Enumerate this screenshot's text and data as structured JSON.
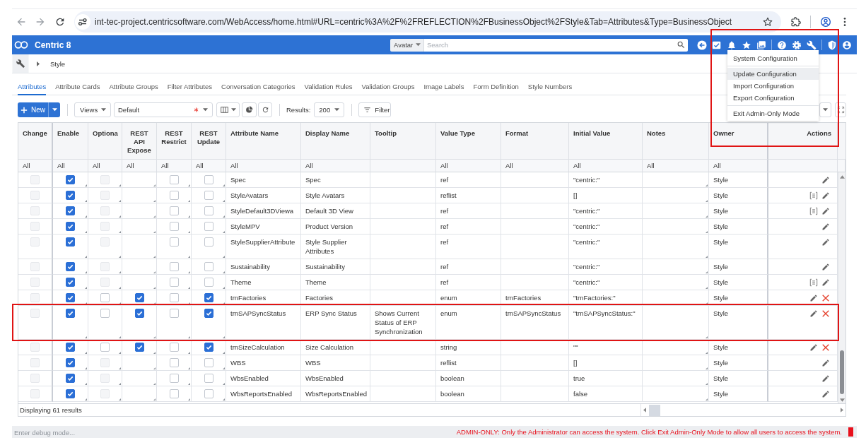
{
  "browser": {
    "url": "int-tec-project.centricsoftware.com/WebAccess/home.html#URL=centric%3A%2F%2FREFLECTION%2FBusinessObject%2FStyle&Tab=Attributes&Type=BusinessObject"
  },
  "app_header": {
    "title": "Centric 8",
    "search_scope": "Avatar",
    "search_placeholder": "Search"
  },
  "admin_menu": {
    "annotated": true,
    "groups": [
      {
        "items": [
          {
            "label": "System Configuration",
            "highlighted": false
          }
        ]
      },
      {
        "items": [
          {
            "label": "Update Configuration",
            "highlighted": true
          },
          {
            "label": "Import Configuration",
            "highlighted": false
          },
          {
            "label": "Export Configuration",
            "highlighted": false
          }
        ]
      },
      {
        "items": [
          {
            "label": "Exit Admin-Only Mode",
            "highlighted": false
          }
        ]
      }
    ]
  },
  "breadcrumb": [
    "Style"
  ],
  "tabs": [
    {
      "label": "Attributes",
      "selected": true
    },
    {
      "label": "Attribute Cards",
      "selected": false
    },
    {
      "label": "Attribute Groups",
      "selected": false
    },
    {
      "label": "Filter Attributes",
      "selected": false
    },
    {
      "label": "Conversation Categories",
      "selected": false
    },
    {
      "label": "Validation Rules",
      "selected": false
    },
    {
      "label": "Validation Groups",
      "selected": false
    },
    {
      "label": "Image Labels",
      "selected": false
    },
    {
      "label": "Form Definition",
      "selected": false
    },
    {
      "label": "Style Numbers",
      "selected": false
    }
  ],
  "toolbar": {
    "new_label": "New",
    "views_label": "Views",
    "view": {
      "value": "Default",
      "required": true
    },
    "results_label": "Results:",
    "results_value": "200",
    "filter_label": "Filter"
  },
  "table": {
    "columns": [
      {
        "label": "Change",
        "filter": "All",
        "editable": false
      },
      {
        "label": "Enable",
        "filter": "All",
        "editable": true
      },
      {
        "label": "Optiona",
        "filter": "All",
        "editable": true
      },
      {
        "label": "REST API Expose",
        "filter": "All",
        "editable": true
      },
      {
        "label": "REST Restrict",
        "filter": "All",
        "editable": true
      },
      {
        "label": "REST Update",
        "filter": "All",
        "editable": true
      },
      {
        "label": "Attribute Name",
        "filter": "All",
        "editable": false
      },
      {
        "label": "Display Name",
        "filter": "All",
        "editable": false
      },
      {
        "label": "Tooltip",
        "editable": false
      },
      {
        "label": "Value Type",
        "filter": "All",
        "editable": false
      },
      {
        "label": "Format",
        "filter": "All",
        "editable": false
      },
      {
        "label": "Initial Value",
        "filter": "All",
        "editable": false
      },
      {
        "label": "Notes",
        "filter": "All",
        "editable": true
      },
      {
        "label": "Owner",
        "filter": "All",
        "editable": false
      },
      {
        "label": "Actions",
        "editable": false
      }
    ],
    "rows": [
      {
        "change": {
          "checked": false,
          "disabled": true
        },
        "enabled": {
          "checked": true,
          "disabled": false
        },
        "optional": {
          "checked": false,
          "disabled": true
        },
        "rest_restrict": {
          "checked": false,
          "disabled": false
        },
        "rest_update": {
          "checked": false,
          "disabled": false
        },
        "attribute_name": "Spec",
        "display_name": "Spec",
        "value_type": "ref",
        "initial_value": "\"centric:\"",
        "owner": "Style",
        "details": false,
        "deletable": false,
        "annotated": false
      },
      {
        "change": {
          "checked": false,
          "disabled": true
        },
        "enabled": {
          "checked": true,
          "disabled": false
        },
        "optional": {
          "checked": false,
          "disabled": true
        },
        "rest_restrict": {
          "checked": false,
          "disabled": false
        },
        "rest_update": {
          "checked": false,
          "disabled": false
        },
        "attribute_name": "StyleAvatars",
        "display_name": "Style Avatars",
        "value_type": "reflist",
        "initial_value": "[]",
        "owner": "Style",
        "details": true,
        "deletable": false,
        "annotated": false
      },
      {
        "change": {
          "checked": false,
          "disabled": true
        },
        "enabled": {
          "checked": true,
          "disabled": false
        },
        "optional": {
          "checked": false,
          "disabled": true
        },
        "rest_restrict": {
          "checked": false,
          "disabled": false
        },
        "rest_update": {
          "checked": false,
          "disabled": false
        },
        "attribute_name": "StyleDefault3DViewa",
        "display_name": "Default 3D View",
        "value_type": "ref",
        "initial_value": "\"centric:\"",
        "owner": "Style",
        "details": true,
        "deletable": false,
        "annotated": false
      },
      {
        "change": {
          "checked": false,
          "disabled": true
        },
        "enabled": {
          "checked": true,
          "disabled": false
        },
        "optional": {
          "checked": false,
          "disabled": true
        },
        "rest_restrict": {
          "checked": false,
          "disabled": false
        },
        "rest_update": {
          "checked": false,
          "disabled": false
        },
        "attribute_name": "StyleMPV",
        "display_name": "Product Version",
        "value_type": "ref",
        "initial_value": "\"centric:\"",
        "owner": "Style",
        "details": false,
        "deletable": false,
        "annotated": false
      },
      {
        "change": {
          "checked": false,
          "disabled": true
        },
        "enabled": {
          "checked": true,
          "disabled": false
        },
        "optional": {
          "checked": false,
          "disabled": true
        },
        "rest_restrict": {
          "checked": false,
          "disabled": false
        },
        "rest_update": {
          "checked": false,
          "disabled": false
        },
        "attribute_name": "StyleSupplierAttribute",
        "display_name": "Style Supplier Attributes",
        "value_type": "ref",
        "initial_value": "\"centric:\"",
        "owner": "Style",
        "details": false,
        "deletable": false,
        "annotated": false
      },
      {
        "change": {
          "checked": false,
          "disabled": true
        },
        "enabled": {
          "checked": true,
          "disabled": false
        },
        "optional": {
          "checked": false,
          "disabled": true
        },
        "rest_restrict": {
          "checked": false,
          "disabled": false
        },
        "rest_update": {
          "checked": false,
          "disabled": false
        },
        "attribute_name": "Sustainability",
        "display_name": "Sustainability",
        "value_type": "ref",
        "initial_value": "\"centric:\"",
        "owner": "Style",
        "details": false,
        "deletable": false,
        "annotated": false
      },
      {
        "change": {
          "checked": false,
          "disabled": true
        },
        "enabled": {
          "checked": true,
          "disabled": false
        },
        "optional": {
          "checked": false,
          "disabled": true
        },
        "rest_restrict": {
          "checked": false,
          "disabled": false
        },
        "rest_update": {
          "checked": false,
          "disabled": false
        },
        "attribute_name": "Theme",
        "display_name": "Theme",
        "value_type": "ref",
        "initial_value": "\"centric:\"",
        "owner": "Style",
        "details": true,
        "deletable": false,
        "annotated": false
      },
      {
        "change": {
          "checked": false,
          "disabled": true
        },
        "enabled": {
          "checked": true,
          "disabled": false
        },
        "optional": {
          "checked": false,
          "disabled": false
        },
        "rest_api_exposed": {
          "checked": true,
          "disabled": false
        },
        "rest_restrict": {
          "checked": false,
          "disabled": false
        },
        "rest_update": {
          "checked": true,
          "disabled": false
        },
        "attribute_name": "trnFactories",
        "display_name": "Factories",
        "value_type": "enum",
        "format": "trnFactories",
        "initial_value": "\"trnFactories:\"",
        "owner": "Style",
        "details": false,
        "deletable": true,
        "annotated": false
      },
      {
        "change": {
          "checked": false,
          "disabled": true
        },
        "enabled": {
          "checked": true,
          "disabled": false
        },
        "optional": {
          "checked": false,
          "disabled": false
        },
        "rest_api_exposed": {
          "checked": true,
          "disabled": false
        },
        "rest_restrict": {
          "checked": false,
          "disabled": false
        },
        "rest_update": {
          "checked": true,
          "disabled": false
        },
        "attribute_name": "trnSAPSyncStatus",
        "display_name": "ERP Sync Status",
        "tooltip": "Shows Current Status of ERP Synchronization",
        "value_type": "enum",
        "format": "trnSAPSyncStatus",
        "initial_value": "\"trnSAPSyncStatus:\"",
        "owner": "Style",
        "details": false,
        "deletable": true,
        "annotated": true
      },
      {
        "change": {
          "checked": false,
          "disabled": true
        },
        "enabled": {
          "checked": true,
          "disabled": false
        },
        "optional": {
          "checked": false,
          "disabled": false
        },
        "rest_api_exposed": {
          "checked": true,
          "disabled": false
        },
        "rest_restrict": {
          "checked": false,
          "disabled": false
        },
        "rest_update": {
          "checked": true,
          "disabled": false
        },
        "attribute_name": "trnSizeCalculation",
        "display_name": "Size Calculation",
        "value_type": "string",
        "initial_value": "\"\"",
        "owner": "Style",
        "details": false,
        "deletable": true,
        "annotated": false
      },
      {
        "change": {
          "checked": false,
          "disabled": true
        },
        "enabled": {
          "checked": true,
          "disabled": false
        },
        "optional": {
          "checked": false,
          "disabled": true
        },
        "rest_restrict": {
          "checked": false,
          "disabled": false
        },
        "rest_update": {
          "checked": false,
          "disabled": false
        },
        "attribute_name": "WBS",
        "display_name": "WBS",
        "value_type": "reflist",
        "initial_value": "[]",
        "owner": "Style",
        "details": false,
        "deletable": false,
        "annotated": false
      },
      {
        "change": {
          "checked": false,
          "disabled": true
        },
        "enabled": {
          "checked": true,
          "disabled": false
        },
        "optional": {
          "checked": false,
          "disabled": true
        },
        "rest_restrict": {
          "checked": false,
          "disabled": false
        },
        "rest_update": {
          "checked": false,
          "disabled": false
        },
        "attribute_name": "WbsEnabled",
        "display_name": "WbsEnabled",
        "value_type": "boolean",
        "initial_value": "true",
        "owner": "Style",
        "details": false,
        "deletable": false,
        "annotated": false
      },
      {
        "change": {
          "checked": false,
          "disabled": true
        },
        "enabled": {
          "checked": true,
          "disabled": false
        },
        "optional": {
          "checked": false,
          "disabled": true
        },
        "rest_restrict": {
          "checked": false,
          "disabled": false
        },
        "rest_update": {
          "checked": false,
          "disabled": false
        },
        "attribute_name": "WbsReportsEnabled",
        "display_name": "WbsReportsEnabled",
        "value_type": "boolean",
        "initial_value": "false",
        "owner": "Style",
        "details": false,
        "deletable": false,
        "annotated": false
      }
    ],
    "footer": "Displaying 61 results"
  },
  "status_bar": {
    "debug_placeholder": "Enter debug mode...",
    "notice": "ADMIN-ONLY: Only the Administrator can access the system. Click Exit Admin-Only Mode to allow all users to access the system."
  }
}
